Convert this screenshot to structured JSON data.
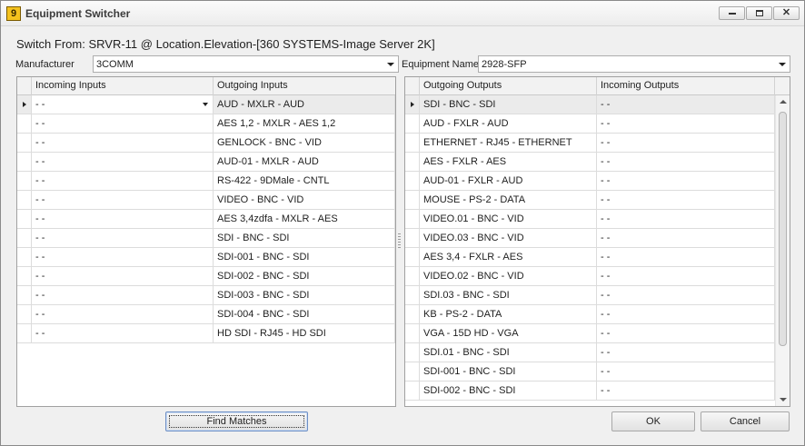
{
  "window": {
    "title": "Equipment Switcher",
    "icon": "app-icon",
    "icon_glyph": "9"
  },
  "switch_from": "Switch From: SRVR-11 @ Location.Elevation-[360 SYSTEMS-Image Server 2K]",
  "manufacturer": {
    "label": "Manufacturer",
    "value": "3COMM"
  },
  "equipment_name": {
    "label": "Equipment Name",
    "value": "2928-SFP"
  },
  "inputs_grid": {
    "columns": [
      "Incoming Inputs",
      "Outgoing Inputs"
    ],
    "rows": [
      [
        "- -",
        "AUD - MXLR - AUD"
      ],
      [
        "- -",
        "AES 1,2 - MXLR - AES 1,2"
      ],
      [
        "- -",
        "GENLOCK - BNC - VID"
      ],
      [
        "- -",
        "AUD-01 - MXLR - AUD"
      ],
      [
        "- -",
        "RS-422 - 9DMale - CNTL"
      ],
      [
        "- -",
        "VIDEO - BNC - VID"
      ],
      [
        "- -",
        "AES 3,4zdfa - MXLR - AES"
      ],
      [
        "- -",
        "SDI - BNC - SDI"
      ],
      [
        "- -",
        "SDI-001 - BNC - SDI"
      ],
      [
        "- -",
        "SDI-002 - BNC - SDI"
      ],
      [
        "- -",
        "SDI-003 - BNC - SDI"
      ],
      [
        "- -",
        "SDI-004 - BNC - SDI"
      ],
      [
        "- -",
        "HD SDI - RJ45 - HD SDI"
      ]
    ]
  },
  "outputs_grid": {
    "columns": [
      "Outgoing Outputs",
      "Incoming Outputs"
    ],
    "rows": [
      [
        "SDI - BNC - SDI",
        "- -"
      ],
      [
        "AUD - FXLR - AUD",
        "- -"
      ],
      [
        "ETHERNET - RJ45 - ETHERNET",
        "- -"
      ],
      [
        "AES - FXLR - AES",
        "- -"
      ],
      [
        "AUD-01 - FXLR - AUD",
        "- -"
      ],
      [
        "MOUSE - PS-2 - DATA",
        "- -"
      ],
      [
        "VIDEO.01 - BNC - VID",
        "- -"
      ],
      [
        "VIDEO.03 - BNC - VID",
        "- -"
      ],
      [
        "AES 3,4 - FXLR - AES",
        "- -"
      ],
      [
        "VIDEO.02 - BNC - VID",
        "- -"
      ],
      [
        "SDI.03 - BNC - SDI",
        "- -"
      ],
      [
        "KB - PS-2 - DATA",
        "- -"
      ],
      [
        "VGA - 15D HD - VGA",
        "- -"
      ],
      [
        "SDI.01 - BNC - SDI",
        "- -"
      ],
      [
        "SDI-001 - BNC - SDI",
        "- -"
      ],
      [
        "SDI-002 - BNC - SDI",
        "- -"
      ]
    ]
  },
  "buttons": {
    "find_matches": "Find Matches",
    "ok": "OK",
    "cancel": "Cancel"
  },
  "colors": {
    "window_bg": "#f0f0f0",
    "selected_row": "#ebebeb",
    "focus_border": "#6d8ec4"
  }
}
